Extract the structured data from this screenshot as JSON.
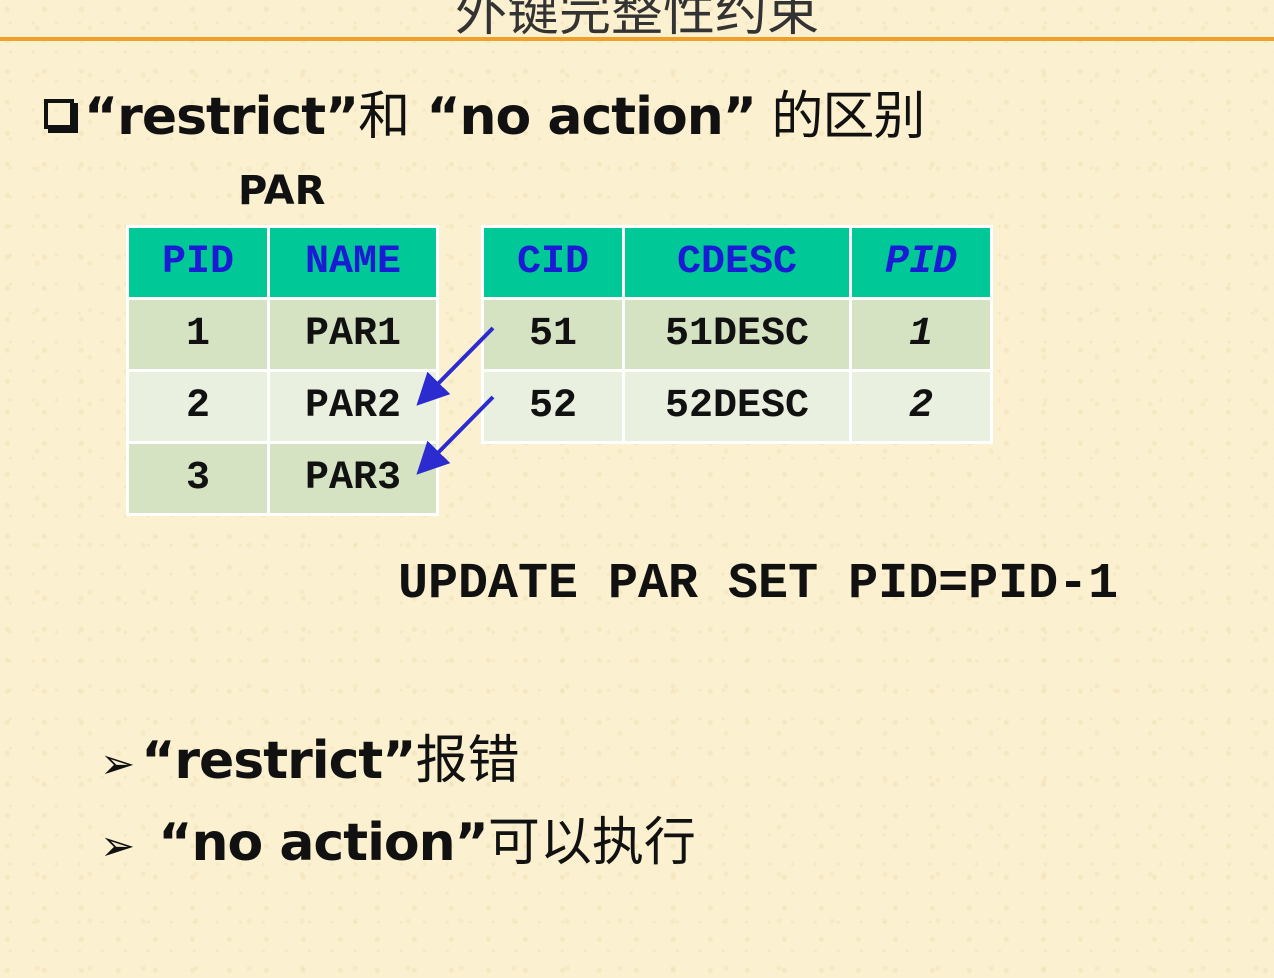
{
  "title_partial": "外键完整性约束",
  "heading": {
    "q1": "“restrict”",
    "and": "和",
    "q2": "“no action”",
    "suffix": " 的区别"
  },
  "par_label": "PAR",
  "par_table": {
    "headers": [
      "PID",
      "NAME"
    ],
    "rows": [
      [
        "1",
        "PAR1"
      ],
      [
        "2",
        "PAR2"
      ],
      [
        "3",
        "PAR3"
      ]
    ]
  },
  "child_table": {
    "headers": [
      "CID",
      "CDESC",
      "PID"
    ],
    "rows": [
      [
        "51",
        "51DESC",
        "1"
      ],
      [
        "52",
        "52DESC",
        "2"
      ]
    ]
  },
  "sql": "UPDATE PAR SET PID=PID-1",
  "results": [
    {
      "bullet": "➢",
      "key": "“restrict”",
      "text": "报错"
    },
    {
      "bullet": "➢",
      "key": " “no action”",
      "text": "可以执行"
    }
  ],
  "colors": {
    "header_bg": "#00c896",
    "header_text": "#1b1bd6",
    "row_odd": "#d5e3c3",
    "row_even": "#eaf0e0",
    "rule": "#f0a02a",
    "arrow": "#2b2bd0"
  },
  "icons": [
    "checkbox-bullet-icon",
    "arrow-bullet-icon",
    "reference-arrow-icon"
  ]
}
